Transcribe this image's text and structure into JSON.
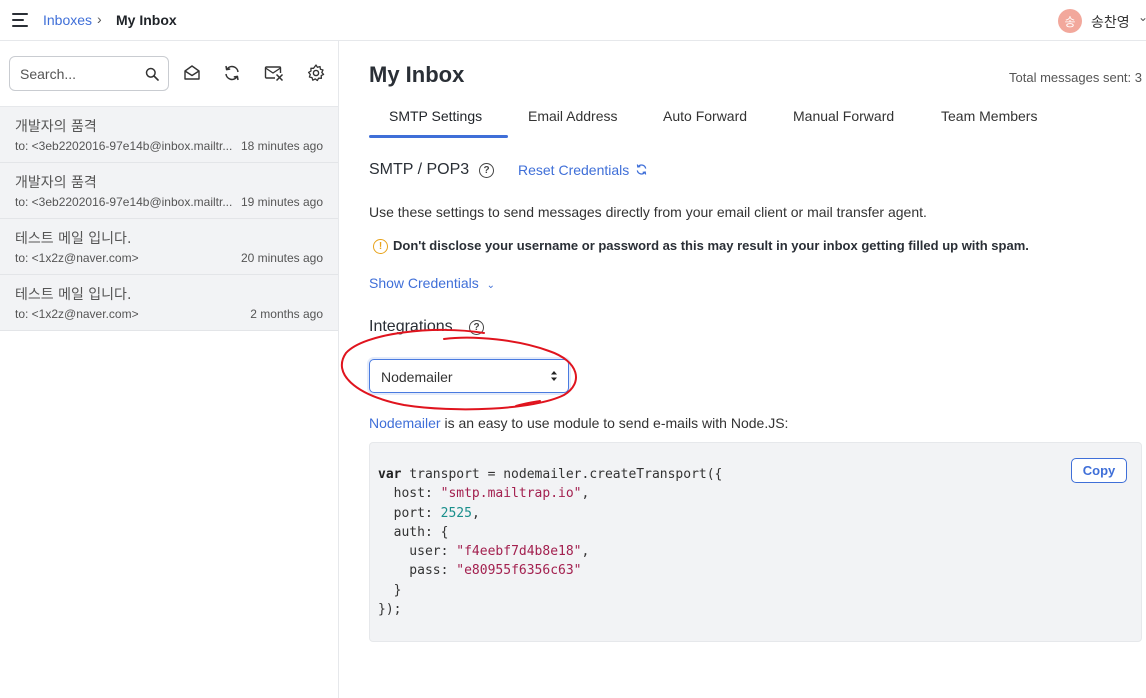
{
  "topbar": {
    "breadcrumb_parent": "Inboxes",
    "breadcrumb_separator": "›",
    "breadcrumb_current": "My Inbox",
    "avatar_initial": "송",
    "username": "송찬영"
  },
  "sidebar": {
    "search_placeholder": "Search...",
    "messages": [
      {
        "subject": "개발자의 품격",
        "to": "to: <3eb2202016-97e14b@inbox.mailtr...",
        "time": "18 minutes ago"
      },
      {
        "subject": "개발자의 품격",
        "to": "to: <3eb2202016-97e14b@inbox.mailtr...",
        "time": "19 minutes ago"
      },
      {
        "subject": "테스트 메일 입니다.",
        "to": "to: <1x2z@naver.com>",
        "time": "20 minutes ago"
      },
      {
        "subject": "테스트 메일 입니다.",
        "to": "to: <1x2z@naver.com>",
        "time": "2 months ago"
      }
    ]
  },
  "main": {
    "title": "My Inbox",
    "total_sent": "Total messages sent: 3",
    "tabs": [
      {
        "label": "SMTP Settings"
      },
      {
        "label": "Email Address"
      },
      {
        "label": "Auto Forward"
      },
      {
        "label": "Manual Forward"
      },
      {
        "label": "Team Members"
      }
    ],
    "smtp_title": "SMTP / POP3",
    "reset_credentials": "Reset Credentials",
    "description": "Use these settings to send messages directly from your email client or mail transfer agent.",
    "warning": "Don't disclose your username or password as this may result in your inbox getting filled up with spam.",
    "show_credentials": "Show Credentials",
    "integrations_title": "Integrations",
    "integration_selected": "Nodemailer",
    "intro_link": "Nodemailer",
    "intro_text": " is an easy to use module to send e-mails with Node.JS:",
    "copy_label": "Copy",
    "code": {
      "kw_var": "var",
      "line1_rest": " transport = nodemailer.createTransport({",
      "host_key": "  host: ",
      "host_val": "\"smtp.mailtrap.io\"",
      "port_key": "  port: ",
      "port_val": "2525",
      "auth_open": "  auth: {",
      "user_key": "    user: ",
      "user_val": "\"f4eebf7d4b8e18\"",
      "pass_key": "    pass: ",
      "pass_val": "\"e80955f6356c63\"",
      "auth_close": "  }",
      "end": "});"
    }
  },
  "colors": {
    "accent": "#3f6fd8",
    "warning": "#e8a31a",
    "annotation": "#e0141e",
    "sidebar_item_bg": "#f2f3f5"
  }
}
